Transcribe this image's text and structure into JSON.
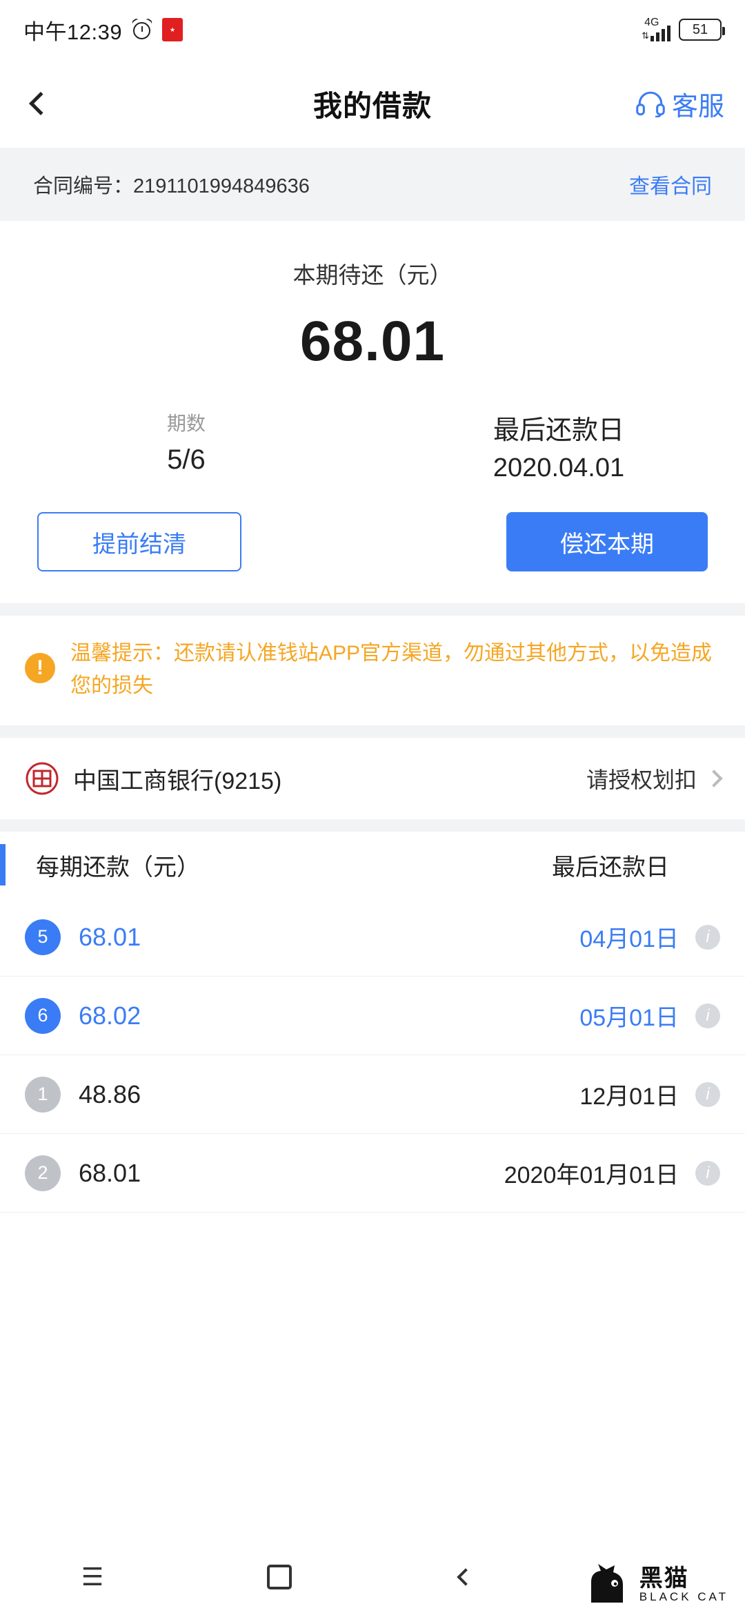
{
  "status_bar": {
    "time": "中午12:39",
    "alarm_icon": "alarm-clock-icon",
    "app_icon": "red-app-icon",
    "network": "4G",
    "battery": "51"
  },
  "header": {
    "back_icon": "chevron-left-icon",
    "title": "我的借款",
    "service_icon": "headset-icon",
    "service_label": "客服"
  },
  "contract": {
    "number_label": "合同编号：2191101994849636",
    "view_link": "查看合同"
  },
  "summary": {
    "amount_label": "本期待还（元）",
    "amount_value": "68.01",
    "period_label": "期数",
    "period_value": "5/6",
    "due_label": "最后还款日",
    "due_value": "2020.04.01",
    "settle_button": "提前结清",
    "repay_button": "偿还本期"
  },
  "tip": {
    "icon": "warning-exclamation-icon",
    "text": "温馨提示：还款请认准钱站APP官方渠道，勿通过其他方式，以免造成您的损失",
    "color": "#f5a623"
  },
  "bank": {
    "logo": "icbc-bank-logo",
    "name": "中国工商银行(9215)",
    "action": "请授权划扣",
    "chevron": "chevron-right-icon"
  },
  "schedule": {
    "col_amount": "每期还款（元）",
    "col_date": "最后还款日",
    "rows": [
      {
        "index": "5",
        "amount": "68.01",
        "date": "04月01日",
        "state": "active"
      },
      {
        "index": "6",
        "amount": "68.02",
        "date": "05月01日",
        "state": "active"
      },
      {
        "index": "1",
        "amount": "48.86",
        "date": "12月01日",
        "state": "paid"
      },
      {
        "index": "2",
        "amount": "68.01",
        "date": "2020年01月01日",
        "state": "paid"
      }
    ],
    "info_icon": "info-icon"
  },
  "navbar": {
    "menu_icon": "menu-icon",
    "home_icon": "home-square-icon",
    "back_icon": "nav-back-icon"
  },
  "watermark": {
    "cat_icon": "black-cat-logo",
    "cn": "黑猫",
    "en": "BLACK CAT"
  },
  "colors": {
    "accent": "#3a7cf5",
    "warning": "#f5a623",
    "band": "#f2f3f5"
  }
}
